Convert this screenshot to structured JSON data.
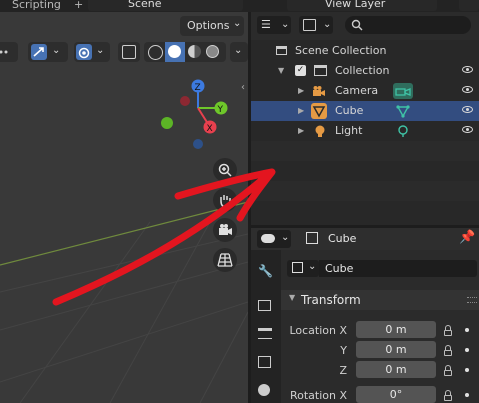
{
  "topbar": {
    "workspace_tab": "Scripting",
    "add_label": "+",
    "scene_name": "Scene",
    "view_layer_name": "View Layer"
  },
  "viewport": {
    "options_label": "Options",
    "gizmo_axes": {
      "x": "X",
      "y": "Y",
      "z": "Z"
    },
    "colors": {
      "x": "#e8404e",
      "y": "#6ec72a",
      "z": "#3c7ae0",
      "grid_line": "#4a4a4a",
      "x_axis_line": "#6f8a3d"
    }
  },
  "outliner": {
    "search_placeholder": "",
    "items": [
      {
        "label": "Scene Collection",
        "icon": "scene-collection-icon"
      },
      {
        "label": "Collection",
        "icon": "collection-icon",
        "checked": true
      },
      {
        "label": "Camera",
        "icon": "camera-icon",
        "data_icon": "camera-data-icon"
      },
      {
        "label": "Cube",
        "icon": "mesh-icon",
        "data_icon": "mesh-data-icon",
        "selected": true
      },
      {
        "label": "Light",
        "icon": "light-icon",
        "data_icon": "light-data-icon"
      }
    ],
    "colors": {
      "selected_row": "#334d80",
      "object_orange": "#e59a44",
      "data_teal": "#3fc3a6"
    }
  },
  "properties": {
    "header_object": "Cube",
    "name_field": "Cube",
    "panel_title": "Transform",
    "fields": [
      {
        "label": "Location X",
        "value": "0 m"
      },
      {
        "label": "Y",
        "value": "0 m"
      },
      {
        "label": "Z",
        "value": "0 m"
      },
      {
        "label": "Rotation X",
        "value": "0°"
      }
    ]
  },
  "annotation": {
    "shape": "hand-drawn-arrow",
    "color": "#e3151f"
  }
}
